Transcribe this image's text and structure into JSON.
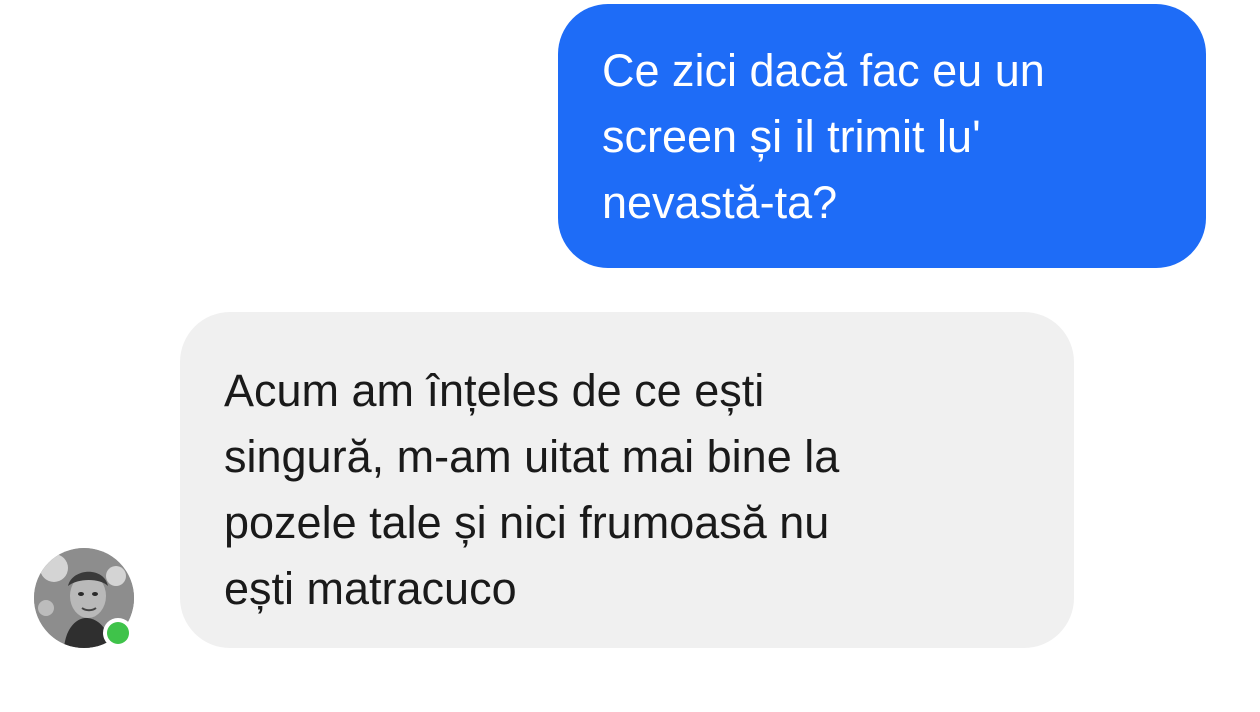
{
  "conversation": {
    "messages": [
      {
        "sender": "self",
        "text": "Ce zici dacă fac eu un\nscreen și il trimit lu'\nnevastă-ta?"
      },
      {
        "sender": "contact",
        "text": "Acum am înțeles de ce ești\nsingură, m-am uitat mai bine la\npozele tale și nici frumoasă nu\nești matracuco"
      }
    ],
    "contact": {
      "avatar": "profile-photo",
      "online": true
    }
  },
  "colors": {
    "sent_bubble": "#1e6cf7",
    "received_bubble": "#f0f0f0",
    "online_indicator": "#3fc34a"
  }
}
